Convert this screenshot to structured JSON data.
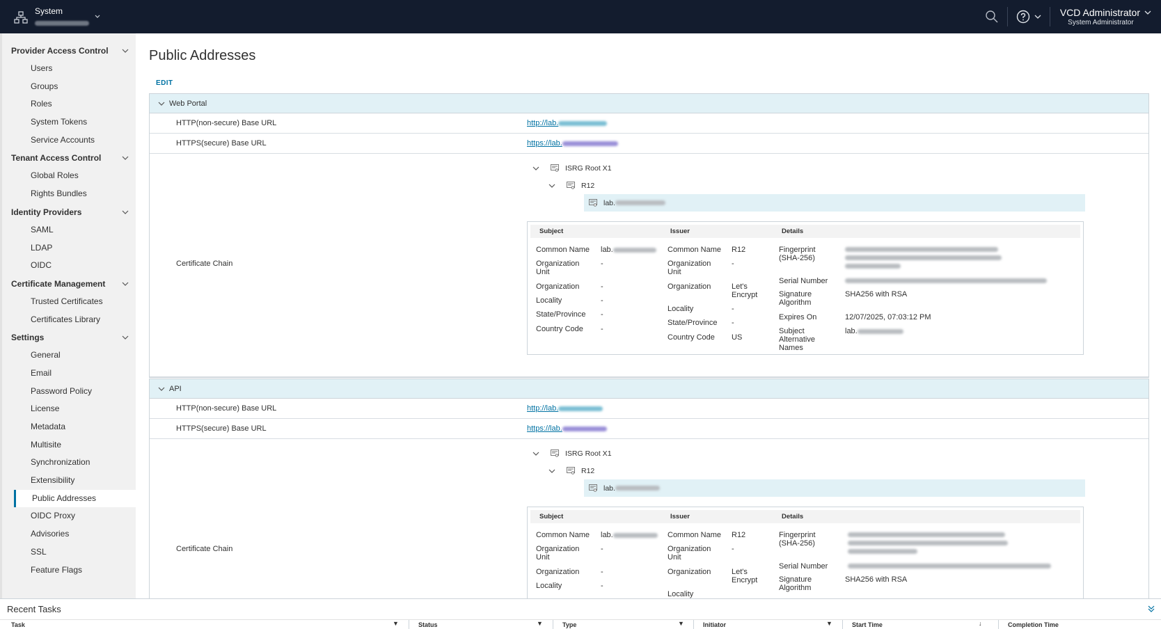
{
  "header": {
    "context_label": "System",
    "user_name": "VCD Administrator",
    "user_role": "System Administrator"
  },
  "sidebar": {
    "groups": [
      {
        "label": "Provider Access Control",
        "items": [
          "Users",
          "Groups",
          "Roles",
          "System Tokens",
          "Service Accounts"
        ]
      },
      {
        "label": "Tenant Access Control",
        "items": [
          "Global Roles",
          "Rights Bundles"
        ]
      },
      {
        "label": "Identity Providers",
        "items": [
          "SAML",
          "LDAP",
          "OIDC"
        ]
      },
      {
        "label": "Certificate Management",
        "items": [
          "Trusted Certificates",
          "Certificates Library"
        ]
      },
      {
        "label": "Settings",
        "items": [
          "General",
          "Email",
          "Password Policy",
          "License",
          "Metadata",
          "Multisite",
          "Synchronization",
          "Extensibility",
          "Public Addresses",
          "OIDC Proxy",
          "Advisories",
          "SSL",
          "Feature Flags"
        ]
      }
    ],
    "active_item": "Public Addresses"
  },
  "page": {
    "title": "Public Addresses",
    "edit_label": "EDIT"
  },
  "web_portal": {
    "section_label": "Web Portal",
    "http_label": "HTTP(non-secure) Base URL",
    "http_value": "http://lab.",
    "https_label": "HTTPS(secure) Base URL",
    "https_value": "https://lab.",
    "chain_label": "Certificate Chain",
    "tree": {
      "root": "ISRG Root X1",
      "intermediate": "R12",
      "leaf": "lab."
    }
  },
  "api": {
    "section_label": "API",
    "http_label": "HTTP(non-secure) Base URL",
    "http_value": "http://lab.",
    "https_label": "HTTPS(secure) Base URL",
    "https_value": "https://lab.",
    "chain_label": "Certificate Chain",
    "tree": {
      "root": "ISRG Root X1",
      "intermediate": "R12",
      "leaf": "lab."
    }
  },
  "cert_details": {
    "headers": {
      "subject": "Subject",
      "issuer": "Issuer",
      "details": "Details"
    },
    "subject": {
      "common_name_key": "Common Name",
      "common_name": "lab.",
      "org_unit_key": "Organization Unit",
      "org_unit": "-",
      "org_key": "Organization",
      "org": "-",
      "locality_key": "Locality",
      "locality": "-",
      "state_key": "State/Province",
      "state": "-",
      "country_key": "Country Code",
      "country": "-"
    },
    "issuer": {
      "common_name_key": "Common Name",
      "common_name": "R12",
      "org_unit_key": "Organization Unit",
      "org_unit": "-",
      "org_key": "Organization",
      "org": "Let's Encrypt",
      "locality_key": "Locality",
      "locality": "-",
      "state_key": "State/Province",
      "state": "-",
      "country_key": "Country Code",
      "country": "US"
    },
    "details": {
      "fingerprint_key": "Fingerprint (SHA-256)",
      "serial_key": "Serial Number",
      "sig_key": "Signature Algorithm",
      "sig": "SHA256 with RSA",
      "expires_key": "Expires On",
      "expires": "12/07/2025, 07:03:12 PM",
      "san_key": "Subject Alternative Names",
      "san": "lab."
    }
  },
  "recent_tasks": {
    "title": "Recent Tasks",
    "columns": [
      "Task",
      "Status",
      "Type",
      "Initiator",
      "Start Time",
      "Completion Time"
    ]
  }
}
